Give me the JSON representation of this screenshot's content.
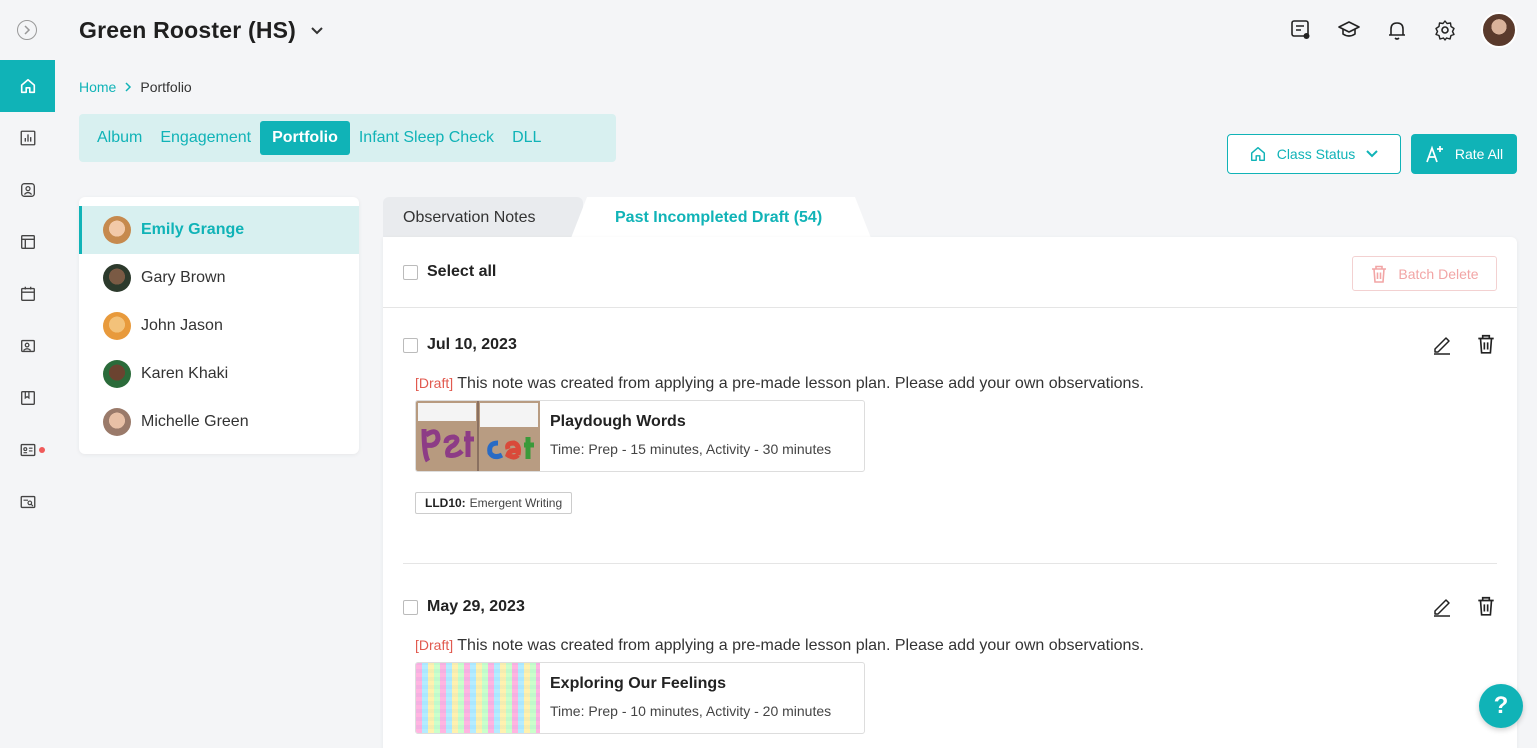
{
  "header": {
    "title": "Green Rooster (HS)"
  },
  "breadcrumb": {
    "home": "Home",
    "current": "Portfolio"
  },
  "tabs": [
    {
      "label": "Album"
    },
    {
      "label": "Engagement"
    },
    {
      "label": "Portfolio",
      "active": true
    },
    {
      "label": "Infant Sleep Check"
    },
    {
      "label": "DLL"
    }
  ],
  "controls": {
    "class_status": "Class Status",
    "rate_all": "Rate All"
  },
  "children": [
    {
      "name": "Emily Grange",
      "active": true
    },
    {
      "name": "Gary Brown"
    },
    {
      "name": "John Jason"
    },
    {
      "name": "Karen Khaki"
    },
    {
      "name": "Michelle Green"
    }
  ],
  "note_tabs": {
    "observation": "Observation Notes",
    "past_draft": "Past Incompleted Draft (54)"
  },
  "list": {
    "select_all": "Select all",
    "batch_delete": "Batch Delete"
  },
  "notes": [
    {
      "date": "Jul 10, 2023",
      "draft_tag": "[Draft]",
      "text": "This note was created from applying a pre-made lesson plan. Please add your own observations.",
      "lesson_name": "Playdough Words",
      "lesson_time": "Time: Prep - 15 minutes, Activity - 30 minutes",
      "tag_code": "LLD10:",
      "tag_label": "Emergent Writing"
    },
    {
      "date": "May 29, 2023",
      "draft_tag": "[Draft]",
      "text": "This note was created from applying a pre-made lesson plan. Please add your own observations.",
      "lesson_name": "Exploring Our Feelings",
      "lesson_time": "Time: Prep - 10 minutes, Activity - 20 minutes"
    }
  ],
  "help": "?",
  "colors": {
    "accent": "#10b3b7",
    "accent_light": "#d8f0f0",
    "draft": "#e15a4f",
    "danger_light": "#f2a5a5"
  }
}
